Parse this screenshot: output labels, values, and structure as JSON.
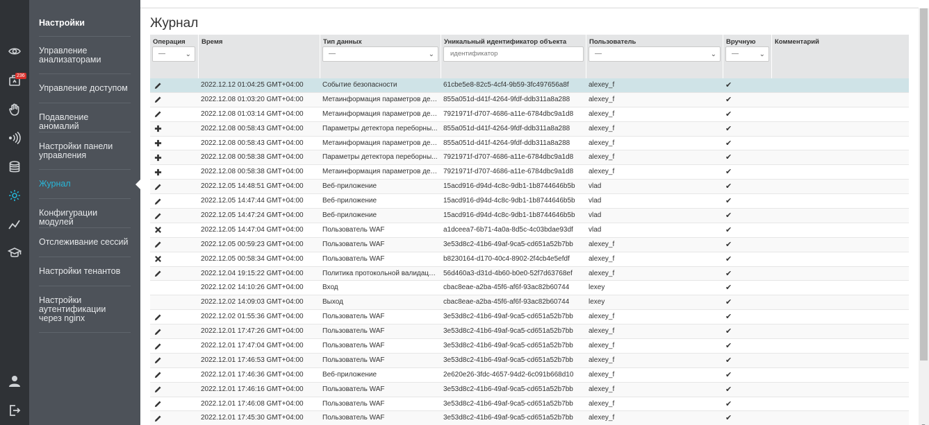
{
  "sidebar": {
    "title": "Настройки",
    "badge": "236",
    "items": [
      {
        "label": "Управление анализаторами"
      },
      {
        "label": "Управление доступом"
      },
      {
        "label": "Подавление аномалий"
      },
      {
        "label": "Настройки панели управления"
      },
      {
        "label": "Журнал"
      },
      {
        "label": "Конфигурации модулей"
      },
      {
        "label": "Отслеживание сессий"
      },
      {
        "label": "Настройки тенантов"
      },
      {
        "label": "Настройки аутентификации через nginx"
      }
    ]
  },
  "page": {
    "title": "Журнал"
  },
  "table": {
    "headers": {
      "operation": "Операция",
      "time": "Время",
      "data_type": "Тип данных",
      "object_id": "Уникальный идентификатор объекта",
      "user": "Пользователь",
      "manual": "Вручную",
      "comment": "Комментарий"
    },
    "filters": {
      "operation": "—",
      "data_type": "—",
      "object_id_placeholder": "идентификатор",
      "user": "—",
      "manual": "—"
    },
    "rows": [
      {
        "op": "edit",
        "time": "2022.12.12 01:04:25 GMT+04:00",
        "type": "Событие безопасности",
        "id": "61cbe5e8-82c5-4cf4-9b59-3fc497656a8f",
        "user": "alexey_f",
        "manual": "✔"
      },
      {
        "op": "edit",
        "time": "2022.12.08 01:03:20 GMT+04:00",
        "type": "Метаинформация параметров дет...",
        "id": "855a051d-d41f-4264-9fdf-ddb311a8a288",
        "user": "alexey_f",
        "manual": "✔"
      },
      {
        "op": "edit",
        "time": "2022.12.08 01:03:14 GMT+04:00",
        "type": "Метаинформация параметров дет...",
        "id": "7921971f-d707-4686-a11e-6784dbc9a1d8",
        "user": "alexey_f",
        "manual": "✔"
      },
      {
        "op": "add",
        "time": "2022.12.08 00:58:43 GMT+04:00",
        "type": "Параметры детектора переборны...",
        "id": "855a051d-d41f-4264-9fdf-ddb311a8a288",
        "user": "alexey_f",
        "manual": "✔"
      },
      {
        "op": "add",
        "time": "2022.12.08 00:58:43 GMT+04:00",
        "type": "Метаинформация параметров дет...",
        "id": "855a051d-d41f-4264-9fdf-ddb311a8a288",
        "user": "alexey_f",
        "manual": "✔"
      },
      {
        "op": "add",
        "time": "2022.12.08 00:58:38 GMT+04:00",
        "type": "Параметры детектора переборны...",
        "id": "7921971f-d707-4686-a11e-6784dbc9a1d8",
        "user": "alexey_f",
        "manual": "✔"
      },
      {
        "op": "add",
        "time": "2022.12.08 00:58:38 GMT+04:00",
        "type": "Метаинформация параметров дет...",
        "id": "7921971f-d707-4686-a11e-6784dbc9a1d8",
        "user": "alexey_f",
        "manual": "✔"
      },
      {
        "op": "edit",
        "time": "2022.12.05 14:48:51 GMT+04:00",
        "type": "Веб-приложение",
        "id": "15acd916-d94d-4c8c-9db1-1b8744646b5b",
        "user": "vlad",
        "manual": "✔"
      },
      {
        "op": "edit",
        "time": "2022.12.05 14:47:44 GMT+04:00",
        "type": "Веб-приложение",
        "id": "15acd916-d94d-4c8c-9db1-1b8744646b5b",
        "user": "vlad",
        "manual": "✔"
      },
      {
        "op": "edit",
        "time": "2022.12.05 14:47:24 GMT+04:00",
        "type": "Веб-приложение",
        "id": "15acd916-d94d-4c8c-9db1-1b8744646b5b",
        "user": "vlad",
        "manual": "✔"
      },
      {
        "op": "delete",
        "time": "2022.12.05 14:47:04 GMT+04:00",
        "type": "Пользователь WAF",
        "id": "a1dceea7-6b71-4a0a-8d5c-4c03bdae93df",
        "user": "vlad",
        "manual": "✔"
      },
      {
        "op": "edit",
        "time": "2022.12.05 00:59:23 GMT+04:00",
        "type": "Пользователь WAF",
        "id": "3e53d8c2-41b6-49af-9ca5-cd651a52b7bb",
        "user": "alexey_f",
        "manual": "✔"
      },
      {
        "op": "delete",
        "time": "2022.12.05 00:58:34 GMT+04:00",
        "type": "Пользователь WAF",
        "id": "b8230164-d170-40c4-8902-2f4cb4e5efdf",
        "user": "alexey_f",
        "manual": "✔"
      },
      {
        "op": "edit",
        "time": "2022.12.04 19:15:22 GMT+04:00",
        "type": "Политика протокольной валидаци...",
        "id": "56d460a3-d31d-4b60-b0e0-52f7d63768ef",
        "user": "alexey_f",
        "manual": "✔"
      },
      {
        "op": "none",
        "time": "2022.12.02 14:10:26 GMT+04:00",
        "type": "Вход",
        "id": "cbac8eae-a2ba-45f6-af6f-93ac82b60744",
        "user": "lexey",
        "manual": "✔"
      },
      {
        "op": "none",
        "time": "2022.12.02 14:09:03 GMT+04:00",
        "type": "Выход",
        "id": "cbac8eae-a2ba-45f6-af6f-93ac82b60744",
        "user": "lexey",
        "manual": "✔"
      },
      {
        "op": "edit",
        "time": "2022.12.02 01:55:36 GMT+04:00",
        "type": "Пользователь WAF",
        "id": "3e53d8c2-41b6-49af-9ca5-cd651a52b7bb",
        "user": "alexey_f",
        "manual": "✔"
      },
      {
        "op": "edit",
        "time": "2022.12.01 17:47:26 GMT+04:00",
        "type": "Пользователь WAF",
        "id": "3e53d8c2-41b6-49af-9ca5-cd651a52b7bb",
        "user": "alexey_f",
        "manual": "✔"
      },
      {
        "op": "edit",
        "time": "2022.12.01 17:47:04 GMT+04:00",
        "type": "Пользователь WAF",
        "id": "3e53d8c2-41b6-49af-9ca5-cd651a52b7bb",
        "user": "alexey_f",
        "manual": "✔"
      },
      {
        "op": "edit",
        "time": "2022.12.01 17:46:53 GMT+04:00",
        "type": "Пользователь WAF",
        "id": "3e53d8c2-41b6-49af-9ca5-cd651a52b7bb",
        "user": "alexey_f",
        "manual": "✔"
      },
      {
        "op": "edit",
        "time": "2022.12.01 17:46:36 GMT+04:00",
        "type": "Веб-приложение",
        "id": "2e620e26-3fdc-4657-94d2-6c091b668d10",
        "user": "alexey_f",
        "manual": "✔"
      },
      {
        "op": "edit",
        "time": "2022.12.01 17:46:16 GMT+04:00",
        "type": "Пользователь WAF",
        "id": "3e53d8c2-41b6-49af-9ca5-cd651a52b7bb",
        "user": "alexey_f",
        "manual": "✔"
      },
      {
        "op": "edit",
        "time": "2022.12.01 17:46:08 GMT+04:00",
        "type": "Пользователь WAF",
        "id": "3e53d8c2-41b6-49af-9ca5-cd651a52b7bb",
        "user": "alexey_f",
        "manual": "✔"
      },
      {
        "op": "edit",
        "time": "2022.12.01 17:45:30 GMT+04:00",
        "type": "Пользователь WAF",
        "id": "3e53d8c2-41b6-49af-9ca5-cd651a52b7bb",
        "user": "alexey_f",
        "manual": "✔"
      }
    ]
  }
}
